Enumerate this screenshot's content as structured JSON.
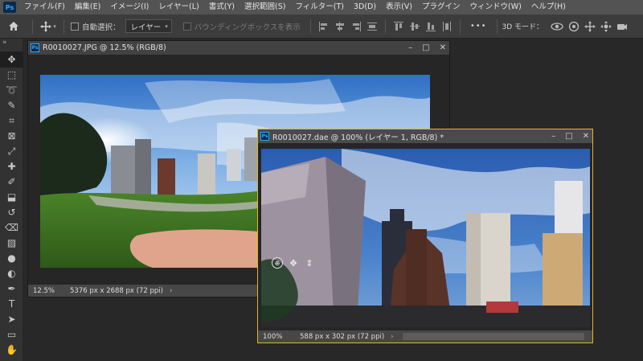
{
  "app": {
    "logo": "Ps",
    "menu": [
      "ファイル(F)",
      "編集(E)",
      "イメージ(I)",
      "レイヤー(L)",
      "書式(Y)",
      "選択範囲(S)",
      "フィルター(T)",
      "3D(D)",
      "表示(V)",
      "プラグイン",
      "ウィンドウ(W)",
      "ヘルプ(H)"
    ]
  },
  "options": {
    "auto_select_label": "自動選択：",
    "auto_select_target": "レイヤー",
    "bounding_box_label": "バウンディングボックスを表示",
    "more": "•••",
    "mode_3d_label": "3D モード："
  },
  "toolbar": {
    "collapse": "»",
    "tools": [
      "move-icon",
      "marquee-icon",
      "lasso-icon",
      "quick-select-icon",
      "crop-icon",
      "frame-icon",
      "eyedropper-icon",
      "healing-icon",
      "brush-icon",
      "stamp-icon",
      "history-brush-icon",
      "eraser-icon",
      "gradient-icon",
      "blur-icon",
      "dodge-icon",
      "pen-icon",
      "type-icon",
      "path-select-icon",
      "shape-icon",
      "hand-icon",
      "zoom-icon"
    ]
  },
  "doc1": {
    "title": "R0010027.JPG @ 12.5% (RGB/8)",
    "zoom": "12.5%",
    "info": "5376 px x 2688 px (72 ppi)",
    "arrow": "›"
  },
  "doc2": {
    "title": "R0010027.dae @ 100% (レイヤー 1, RGB/8) *",
    "zoom": "100%",
    "info": "588 px x 302 px (72 ppi)",
    "arrow": "›"
  },
  "window_buttons": {
    "minimize": "–",
    "maximize": "□",
    "close": "✕"
  },
  "colors": {
    "accent_frame": "#e0b52a",
    "ps_blue": "#31a8ff",
    "ps_dark": "#0b2a4a"
  }
}
